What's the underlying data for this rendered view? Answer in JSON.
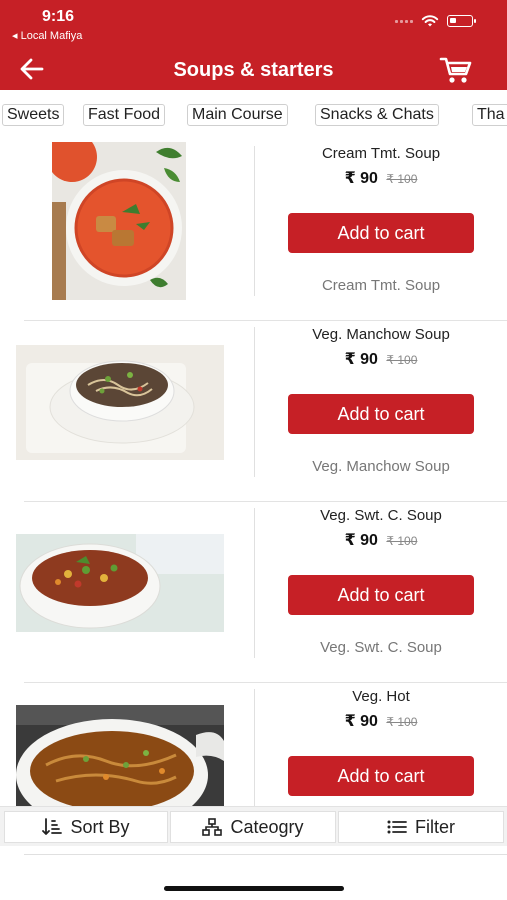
{
  "status_bar": {
    "time": "9:16",
    "back_app": "◂ Local Mafiya"
  },
  "header": {
    "title": "Soups & starters"
  },
  "categories": [
    "Sweets",
    "Fast Food",
    "Main Course",
    "Snacks & Chats",
    "Tha"
  ],
  "items": [
    {
      "name": "Cream Tmt. Soup",
      "price": "₹ 90",
      "old_price": "₹ 100",
      "button": "Add to cart",
      "subtitle": "Cream Tmt. Soup"
    },
    {
      "name": "Veg. Manchow  Soup",
      "price": "₹ 90",
      "old_price": "₹ 100",
      "button": "Add to cart",
      "subtitle": "Veg. Manchow Soup"
    },
    {
      "name": "Veg. Swt. C. Soup",
      "price": "₹ 90",
      "old_price": "₹ 100",
      "button": "Add to cart",
      "subtitle": "Veg. Swt. C. Soup"
    },
    {
      "name": "Veg. Hot",
      "price": "₹ 90",
      "old_price": "₹ 100",
      "button": "Add to cart",
      "subtitle": ""
    }
  ],
  "bottom_bar": {
    "sort": "Sort By",
    "category": "Cateogry",
    "filter": "Filter"
  },
  "colors": {
    "brand": "#c62026"
  }
}
